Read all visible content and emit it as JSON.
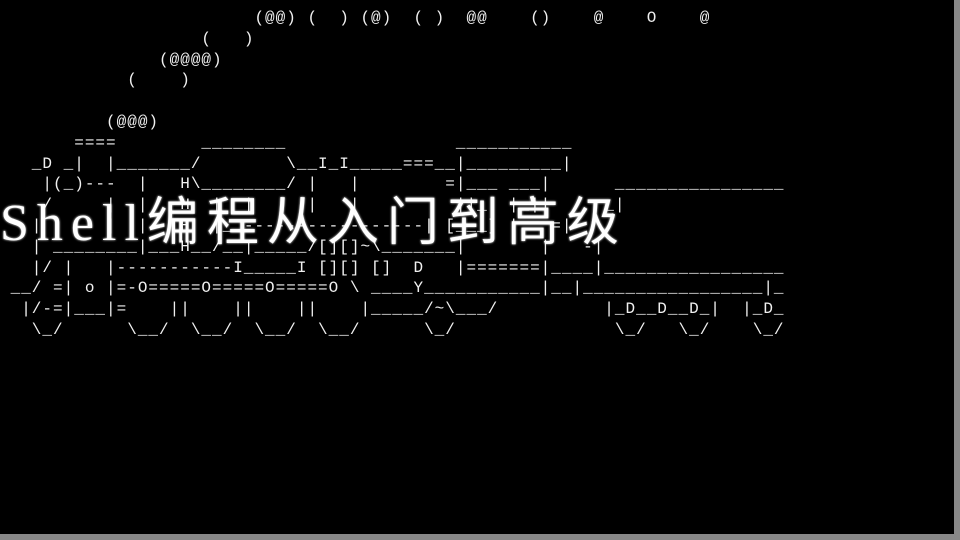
{
  "title": "Shell编程从入门到高级",
  "ascii": {
    "line01": "                        (@@) (  ) (@)  ( )  @@    ()    @    O    @",
    "line02": "                   (   )",
    "line03": "               (@@@@)",
    "line04": "            (    )",
    "line05": "",
    "line06": "          (@@@)",
    "line07": "       ====        ________                ___________",
    "line08": "   _D _|  |_______/        \\__I_I_____===__|_________|",
    "line09": "    |(_)---  |   H\\________/ |   |        =|___ ___|      ________________",
    "line10": "    /     |  |   H  |  |     |   |         ||_| |_||     _|               ",
    "line11": "   |      |  |   H  |__-----------------| [___] |   =|                    ",
    "line12": "   | ________|___H__/__|_____/[][]~\\_______|       |   -|                 ",
    "line13": "   |/ |   |-----------I_____I [][] []  D   |=======|____|_________________",
    "line14": " __/ =| o |=-O=====O=====O=====O \\ ____Y___________|__|_________________|_",
    "line15": "  |/-=|___|=    ||    ||    ||    |_____/~\\___/          |_D__D__D_|  |_D_",
    "line16": "   \\_/      \\__/  \\__/  \\__/  \\__/      \\_/               \\_/   \\_/    \\_/"
  }
}
